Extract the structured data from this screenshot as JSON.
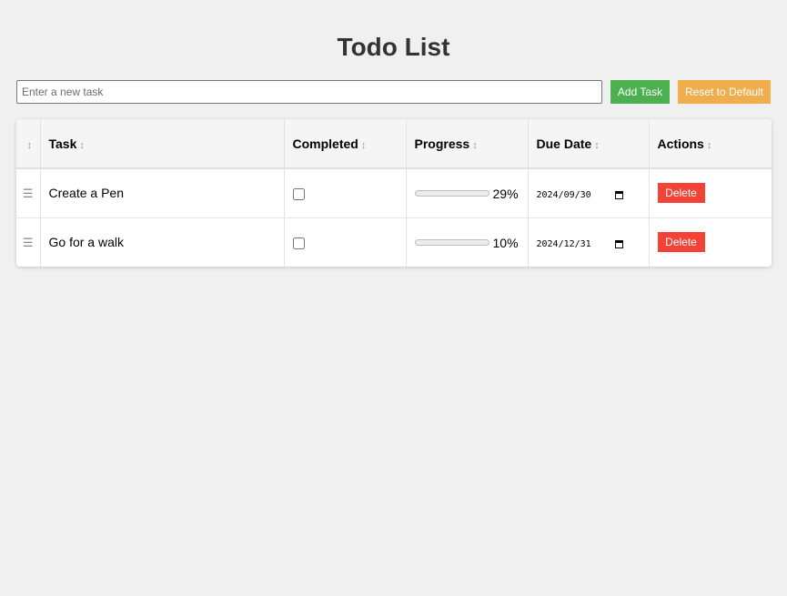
{
  "page": {
    "title": "Todo List"
  },
  "new_task": {
    "placeholder": "Enter a new task",
    "value": ""
  },
  "toolbar": {
    "add_label": "Add Task",
    "reset_label": "Reset to Default"
  },
  "table": {
    "headers": {
      "drag": "",
      "task": "Task",
      "completed": "Completed",
      "progress": "Progress",
      "due_date": "Due Date",
      "actions": "Actions"
    },
    "sort_glyph": "↕",
    "drag_glyph": "☰",
    "rows": [
      {
        "task": "Create a Pen",
        "completed": false,
        "progress": 29,
        "progress_label": "29%",
        "due_date": "2024/09/30",
        "delete_label": "Delete"
      },
      {
        "task": "Go for a walk",
        "completed": false,
        "progress": 10,
        "progress_label": "10%",
        "due_date": "2024/12/31",
        "delete_label": "Delete"
      }
    ]
  },
  "colors": {
    "add_button": "#4caf50",
    "reset_button": "#f0ad4e",
    "delete_button": "#f44336",
    "progress_fill": "#1a73e8"
  },
  "icons": {
    "drag": "drag-handle-icon",
    "sort": "sort-icon",
    "calendar": "calendar-icon"
  }
}
